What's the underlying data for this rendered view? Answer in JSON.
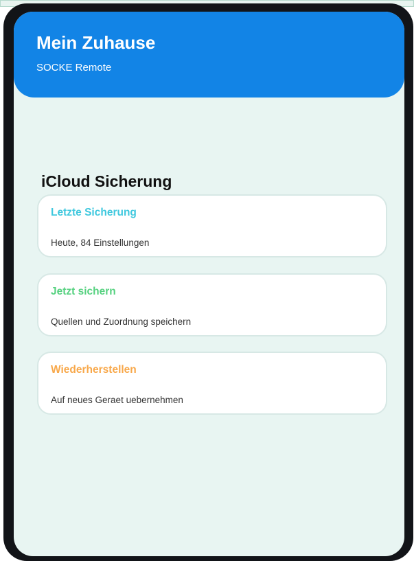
{
  "header": {
    "title": "Mein Zuhause",
    "subtitle": "SOCKE Remote"
  },
  "section": {
    "title": "iCloud Sicherung"
  },
  "cards": [
    {
      "title": "Letzte Sicherung",
      "detail": "Heute, 84 Einstellungen",
      "title_color": "#3fc8de"
    },
    {
      "title": "Jetzt sichern",
      "detail": "Quellen und Zuordnung speichern",
      "title_color": "#55d17f"
    },
    {
      "title": "Wiederherstellen",
      "detail": "Auf neues Geraet uebernehmen",
      "title_color": "#f8a84a"
    }
  ],
  "colors": {
    "header_blue": "#1284e6",
    "screen_background": "#e8f5f2",
    "device_frame": "#121418"
  }
}
